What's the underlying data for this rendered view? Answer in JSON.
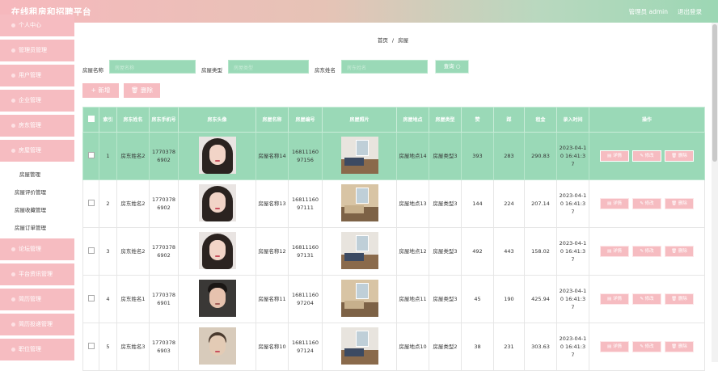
{
  "app": {
    "title": "在线租房和招聘平台",
    "user": "管理员 admin",
    "logout": "退出登录"
  },
  "sidebar": {
    "items": [
      {
        "label": "个人中心"
      },
      {
        "label": "管理员管理"
      },
      {
        "label": "用户管理"
      },
      {
        "label": "企业管理"
      },
      {
        "label": "房东管理"
      },
      {
        "label": "房屋管理"
      },
      {
        "label": "论坛管理"
      },
      {
        "label": "平台资讯管理"
      },
      {
        "label": "简历管理"
      },
      {
        "label": "简历投递管理"
      },
      {
        "label": "职位管理"
      }
    ],
    "subitems": [
      {
        "label": "房屋管理"
      },
      {
        "label": "房屋评价管理"
      },
      {
        "label": "房屋收藏管理"
      },
      {
        "label": "房屋订单管理"
      }
    ]
  },
  "breadcrumb": {
    "home": "首页",
    "separator": "/",
    "current": "房屋"
  },
  "filters": {
    "name_label": "房屋名称",
    "name_placeholder": "房屋名称",
    "type_label": "房屋类型",
    "type_placeholder": "房屋类型",
    "owner_label": "房东姓名",
    "owner_placeholder": "房东姓名",
    "search_label": "查询 ○"
  },
  "toolbar": {
    "add_label": "+ 新增",
    "delete_label": "🗑 删除"
  },
  "table": {
    "headers": [
      "索引",
      "房东姓名",
      "房东手机号",
      "房东头像",
      "房屋名称",
      "房屋编号",
      "房屋照片",
      "房屋地点",
      "房屋类型",
      "赞",
      "踩",
      "租金",
      "录入时间",
      "操作"
    ],
    "actions": {
      "detail": "▤ 详情",
      "edit": "✎ 修改",
      "delete": "🗑 删除"
    },
    "rows": [
      {
        "index": "1",
        "owner": "房东姓名2",
        "phone": "17703786902",
        "avatar": "female-avatar",
        "house_name": "房屋名称14",
        "house_no": "1681116097156",
        "photo": "room-photo",
        "location": "房屋地点14",
        "type": "房屋类型3",
        "likes": "393",
        "dislikes": "283",
        "rent": "290.83",
        "time": "2023-04-10 16:41:37",
        "selected": true
      },
      {
        "index": "2",
        "owner": "房东姓名2",
        "phone": "17703786902",
        "avatar": "female-avatar",
        "house_name": "房屋名称13",
        "house_no": "1681116097111",
        "photo": "room-photo",
        "location": "房屋地点13",
        "type": "房屋类型3",
        "likes": "144",
        "dislikes": "224",
        "rent": "207.14",
        "time": "2023-04-10 16:41:37"
      },
      {
        "index": "3",
        "owner": "房东姓名2",
        "phone": "17703786902",
        "avatar": "female-avatar",
        "house_name": "房屋名称12",
        "house_no": "1681116097131",
        "photo": "room-photo",
        "location": "房屋地点12",
        "type": "房屋类型3",
        "likes": "492",
        "dislikes": "443",
        "rent": "158.02",
        "time": "2023-04-10 16:41:37"
      },
      {
        "index": "4",
        "owner": "房东姓名1",
        "phone": "17703786901",
        "avatar": "male-avatar",
        "house_name": "房屋名称11",
        "house_no": "1681116097204",
        "photo": "room-photo",
        "location": "房屋地点11",
        "type": "房屋类型3",
        "likes": "45",
        "dislikes": "190",
        "rent": "425.94",
        "time": "2023-04-10 16:41:37"
      },
      {
        "index": "5",
        "owner": "房东姓名3",
        "phone": "17703786903",
        "avatar": "vintage-avatar",
        "house_name": "房屋名称10",
        "house_no": "1681116097124",
        "photo": "room-photo",
        "location": "房屋地点10",
        "type": "房屋类型2",
        "likes": "38",
        "dislikes": "231",
        "rent": "303.63",
        "time": "2023-04-10 16:41:37"
      }
    ]
  },
  "colors": {
    "accent_pink": "#f6bcc1",
    "accent_green": "#9ad9b7"
  }
}
